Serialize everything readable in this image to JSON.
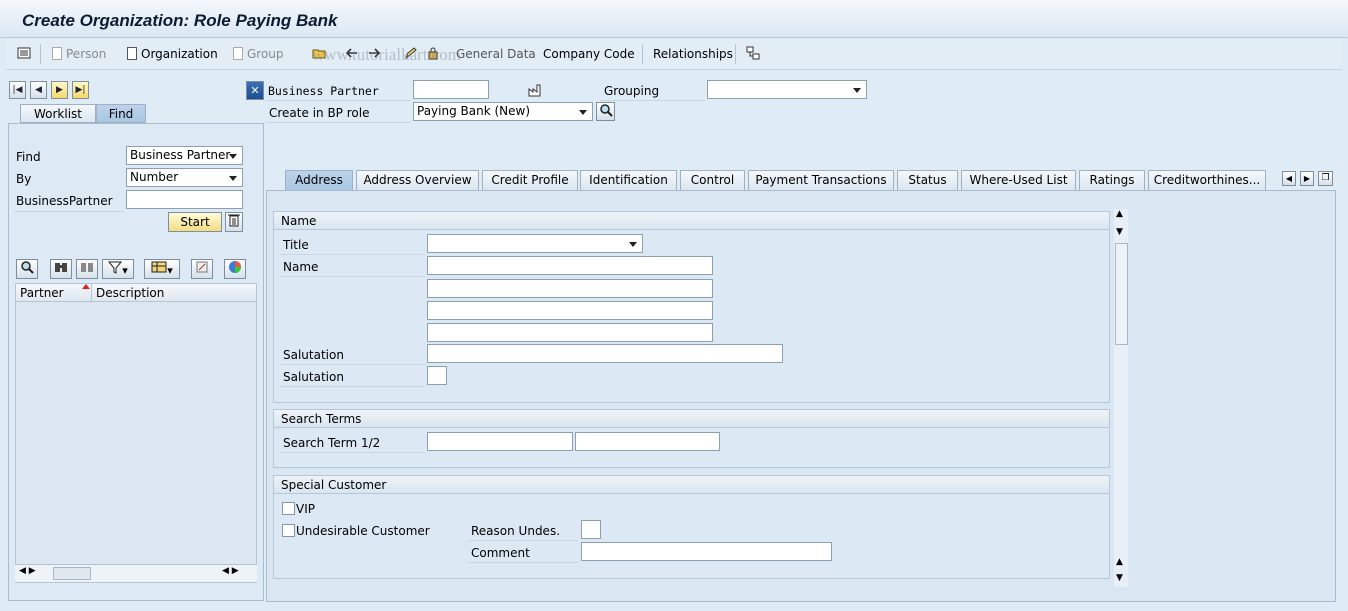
{
  "title": "Create Organization: Role Paying Bank",
  "toolbar": {
    "person": "Person",
    "organization": "Organization",
    "group": "Group",
    "general_data": "General Data",
    "company_code": "Company Code",
    "relationships": "Relationships",
    "watermark": "www.tutorialkart.com"
  },
  "header": {
    "bp_label": "Business Partner",
    "grouping_label": "Grouping",
    "create_role_label": "Create in BP role",
    "create_role_value": "Paying Bank (New)"
  },
  "left": {
    "tabs": [
      "Worklist",
      "Find"
    ],
    "find_label": "Find",
    "find_value": "Business Partner",
    "by_label": "By",
    "by_value": "Number",
    "bp_label": "BusinessPartner",
    "start": "Start",
    "col_partner": "Partner",
    "col_description": "Description"
  },
  "tabs": [
    "Address",
    "Address Overview",
    "Credit Profile",
    "Identification",
    "Control",
    "Payment Transactions",
    "Status",
    "Where-Used List",
    "Ratings",
    "Creditworthines..."
  ],
  "name_group": {
    "header": "Name",
    "title_label": "Title",
    "name_label": "Name",
    "salutation_label": "Salutation",
    "salutation2_label": "Salutation"
  },
  "search_group": {
    "header": "Search Terms",
    "label": "Search Term 1/2"
  },
  "special_group": {
    "header": "Special Customer",
    "vip": "VIP",
    "undesirable": "Undesirable Customer",
    "reason_label": "Reason Undes.",
    "comment_label": "Comment"
  }
}
